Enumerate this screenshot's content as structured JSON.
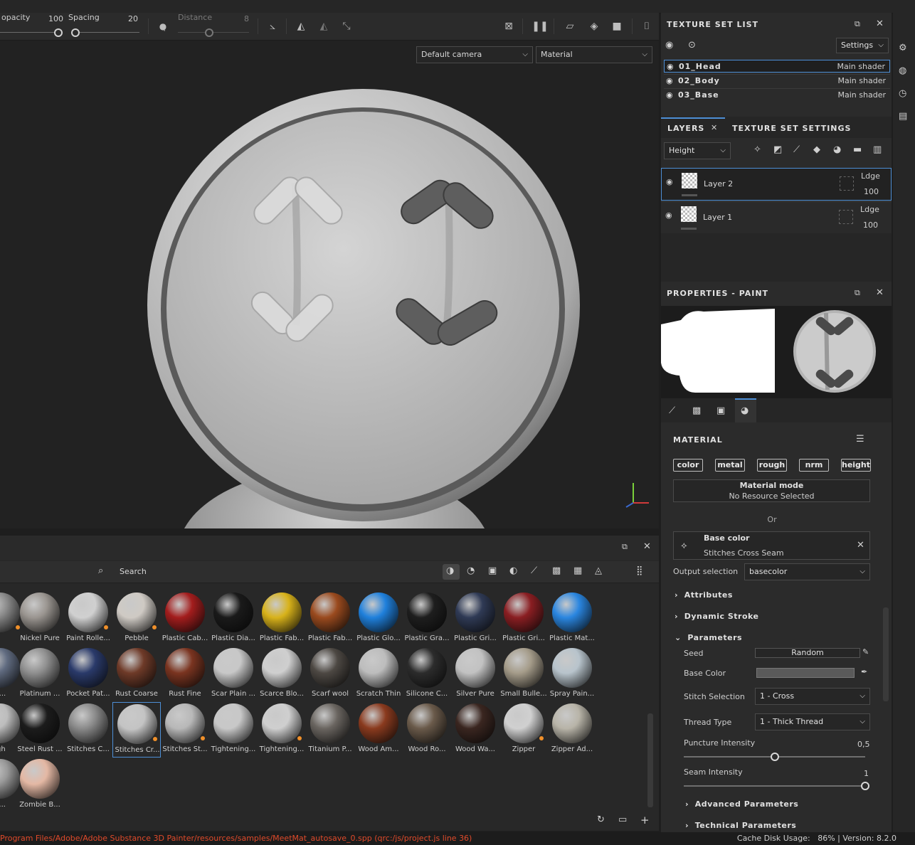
{
  "toolbar": {
    "opacity_label": "opacity",
    "opacity_value": "100",
    "spacing_label": "Spacing",
    "spacing_value": "20",
    "distance_label": "Distance",
    "distance_value": "8"
  },
  "viewport": {
    "camera_select": "Default camera",
    "mode_select": "Material"
  },
  "texture_set_list": {
    "title": "TEXTURE SET LIST",
    "settings_label": "Settings",
    "sets": [
      {
        "name": "01_Head",
        "shader": "Main shader"
      },
      {
        "name": "02_Body",
        "shader": "Main shader"
      },
      {
        "name": "03_Base",
        "shader": "Main shader"
      }
    ]
  },
  "layers_panel": {
    "tab_layers": "LAYERS",
    "tab_texture_set_settings": "TEXTURE SET SETTINGS",
    "channel_select": "Height",
    "layers": [
      {
        "name": "Layer 2",
        "blend": "Ldge",
        "opacity": "100"
      },
      {
        "name": "Layer 1",
        "blend": "Ldge",
        "opacity": "100"
      }
    ]
  },
  "properties": {
    "title": "PROPERTIES - PAINT",
    "material_title": "MATERIAL",
    "channel_buttons": [
      "color",
      "metal",
      "rough",
      "nrm",
      "height"
    ],
    "material_mode_title": "Material mode",
    "material_mode_sub": "No Resource Selected",
    "or_text": "Or",
    "resource_title": "Base color",
    "resource_name": "Stitches Cross Seam",
    "output_selection_label": "Output selection",
    "output_selection_value": "basecolor",
    "sections": {
      "attributes": "Attributes",
      "dynamic_stroke": "Dynamic Stroke",
      "parameters": "Parameters",
      "advanced": "Advanced Parameters",
      "technical": "Technical Parameters"
    },
    "params": {
      "seed_label": "Seed",
      "seed_button": "Random",
      "base_color_label": "Base Color",
      "base_color_value": "#5a5a5a",
      "stitch_selection_label": "Stitch Selection",
      "stitch_selection_value": "1 - Cross",
      "thread_type_label": "Thread Type",
      "thread_type_value": "1 - Thick Thread",
      "puncture_label": "Puncture Intensity",
      "puncture_value": "0,5",
      "puncture_fraction": 0.5,
      "seam_label": "Seam Intensity",
      "seam_value": "1",
      "seam_fraction": 1.0
    }
  },
  "shelf": {
    "search_placeholder": "Search",
    "rows": [
      [
        {
          "name": "",
          "color": "#8a8a8a",
          "dot": true
        },
        {
          "name": "Nickel Pure",
          "color": "#9a9590",
          "dot": false
        },
        {
          "name": "Paint Rolle...",
          "color": "#d0d0d0",
          "dot": true
        },
        {
          "name": "Pebble",
          "color": "#cfcac4",
          "dot": true
        },
        {
          "name": "Plastic Cab...",
          "color": "#a31d1d",
          "dot": false
        },
        {
          "name": "Plastic Dia...",
          "color": "#1a1a1a",
          "dot": false
        },
        {
          "name": "Plastic Fab...",
          "color": "#d8b21a",
          "dot": false
        },
        {
          "name": "Plastic Fab...",
          "color": "#9a4a1e",
          "dot": false
        },
        {
          "name": "Plastic Glo...",
          "color": "#1f80dc",
          "dot": false
        },
        {
          "name": "Plastic Gra...",
          "color": "#1e1e1e",
          "dot": false
        },
        {
          "name": "Plastic Gri...",
          "color": "#2f3a55",
          "dot": false
        },
        {
          "name": "Plastic Gri...",
          "color": "#8a1e22",
          "dot": false
        },
        {
          "name": "Plastic Mat...",
          "color": "#2a86e0",
          "dot": false
        }
      ],
      [
        {
          "name": "ri...",
          "color": "#606b80",
          "dot": false
        },
        {
          "name": "Platinum ...",
          "color": "#8f8f8f",
          "dot": false
        },
        {
          "name": "Pocket Pat...",
          "color": "#2a3a6a",
          "dot": false
        },
        {
          "name": "Rust Coarse",
          "color": "#6e3a28",
          "dot": false
        },
        {
          "name": "Rust Fine",
          "color": "#7a3420",
          "dot": false
        },
        {
          "name": "Scar Plain ...",
          "color": "#c8c8c8",
          "dot": false
        },
        {
          "name": "Scarce Blo...",
          "color": "#cfcfcf",
          "dot": false
        },
        {
          "name": "Scarf wool",
          "color": "#4d4843",
          "dot": false
        },
        {
          "name": "Scratch Thin",
          "color": "#bdbdbd",
          "dot": false
        },
        {
          "name": "Silicone C...",
          "color": "#2c2c2c",
          "dot": false
        },
        {
          "name": "Silver Pure",
          "color": "#c2c2c2",
          "dot": false
        },
        {
          "name": "Small Bulle...",
          "color": "#a59c8a",
          "dot": false
        },
        {
          "name": "Spray Pain...",
          "color": "#b8c4cc",
          "dot": false
        }
      ],
      [
        {
          "name": "igh",
          "color": "#bdbdbd",
          "dot": false
        },
        {
          "name": "Steel Rust ...",
          "color": "#1c1c1c",
          "dot": false
        },
        {
          "name": "Stitches C...",
          "color": "#8a8a8a",
          "dot": false
        },
        {
          "name": "Stitches Cr...",
          "color": "#c4c4c4",
          "dot": true
        },
        {
          "name": "Stitches St...",
          "color": "#b8b8b8",
          "dot": true
        },
        {
          "name": "Tightening...",
          "color": "#c8c8c8",
          "dot": false
        },
        {
          "name": "Tightening...",
          "color": "#cfcfcf",
          "dot": true
        },
        {
          "name": "Titanium P...",
          "color": "#6a6560",
          "dot": false
        },
        {
          "name": "Wood Am...",
          "color": "#8a3a1e",
          "dot": false
        },
        {
          "name": "Wood Ro...",
          "color": "#6a5a4a",
          "dot": false
        },
        {
          "name": "Wood Wa...",
          "color": "#3a2620",
          "dot": false
        },
        {
          "name": "Zipper",
          "color": "#d0d0d0",
          "dot": true
        },
        {
          "name": "Zipper Ad...",
          "color": "#b8b4a8",
          "dot": false
        }
      ],
      [
        {
          "name": "d...",
          "color": "#9a9a9a",
          "dot": false
        },
        {
          "name": "Zombie B...",
          "color": "#e4b8a4",
          "dot": false
        }
      ]
    ]
  },
  "status": {
    "path": "Program Files/Adobe/Adobe Substance 3D Painter/resources/samples/MeetMat_autosave_0.spp (qrc:/js/project.js line 36)",
    "cache": "Cache Disk Usage:   86% | Version: 8.2.0"
  }
}
